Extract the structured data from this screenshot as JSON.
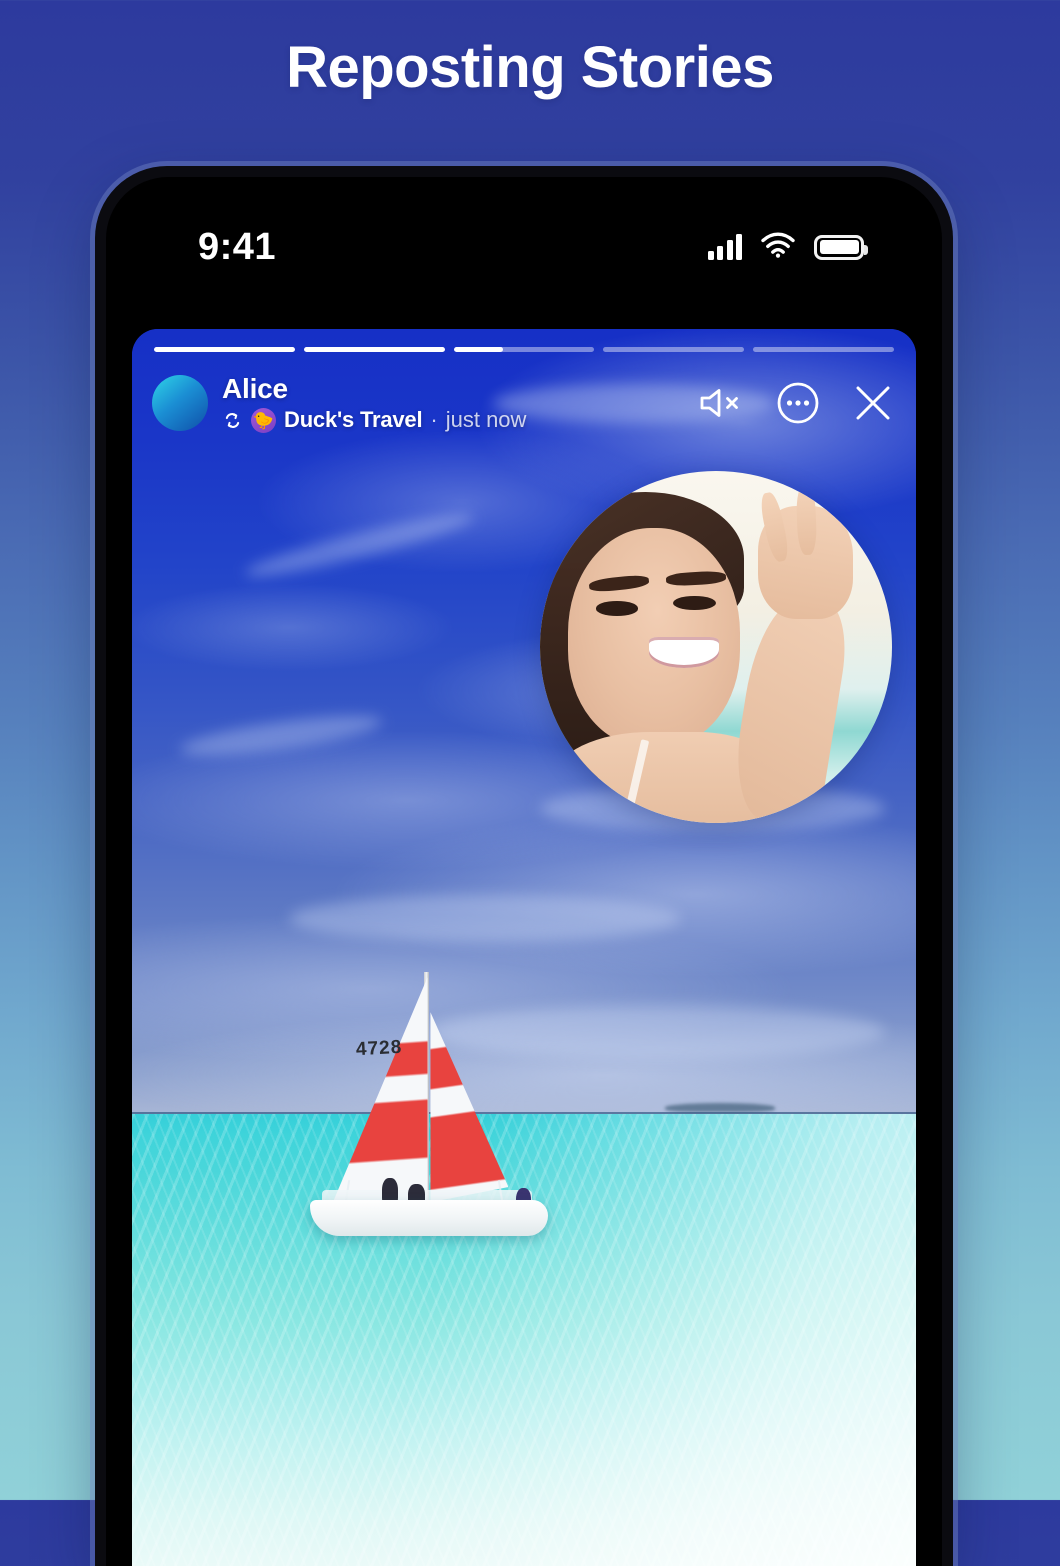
{
  "page": {
    "title": "Reposting Stories"
  },
  "status_bar": {
    "time": "9:41",
    "signal_icon": "cellular-signal-icon",
    "wifi_icon": "wifi-icon",
    "battery_icon": "battery-full-icon"
  },
  "story": {
    "progress": {
      "segments": [
        100,
        100,
        35,
        0,
        0
      ],
      "count": 5
    },
    "header": {
      "avatar_name": "alice-avatar",
      "username": "Alice",
      "repost_icon": "repost-arrows-icon",
      "source_emoji": "🐤",
      "source_name": "Duck's Travel",
      "separator": "·",
      "timestamp": "just now"
    },
    "actions": [
      {
        "name": "mute-audio-button",
        "icon": "speaker-muted-icon",
        "label": "Mute"
      },
      {
        "name": "more-options-button",
        "icon": "more-horizontal-circle-icon",
        "label": "More"
      },
      {
        "name": "close-story-button",
        "icon": "close-x-icon",
        "label": "Close"
      }
    ],
    "media": {
      "scene": "sailboat-on-turquoise-lagoon",
      "sail_number": "4728",
      "selfie_overlay": "selfie-circle-peace-sign"
    }
  },
  "colors": {
    "bg_top": "#2d3a9e",
    "bg_bottom": "#90d1d8",
    "sky": "#1630c6",
    "sea": "#35cfd9",
    "sail_red": "#e8433f",
    "accent_white": "#ffffff",
    "duck_badge": "#7b3fc4"
  }
}
